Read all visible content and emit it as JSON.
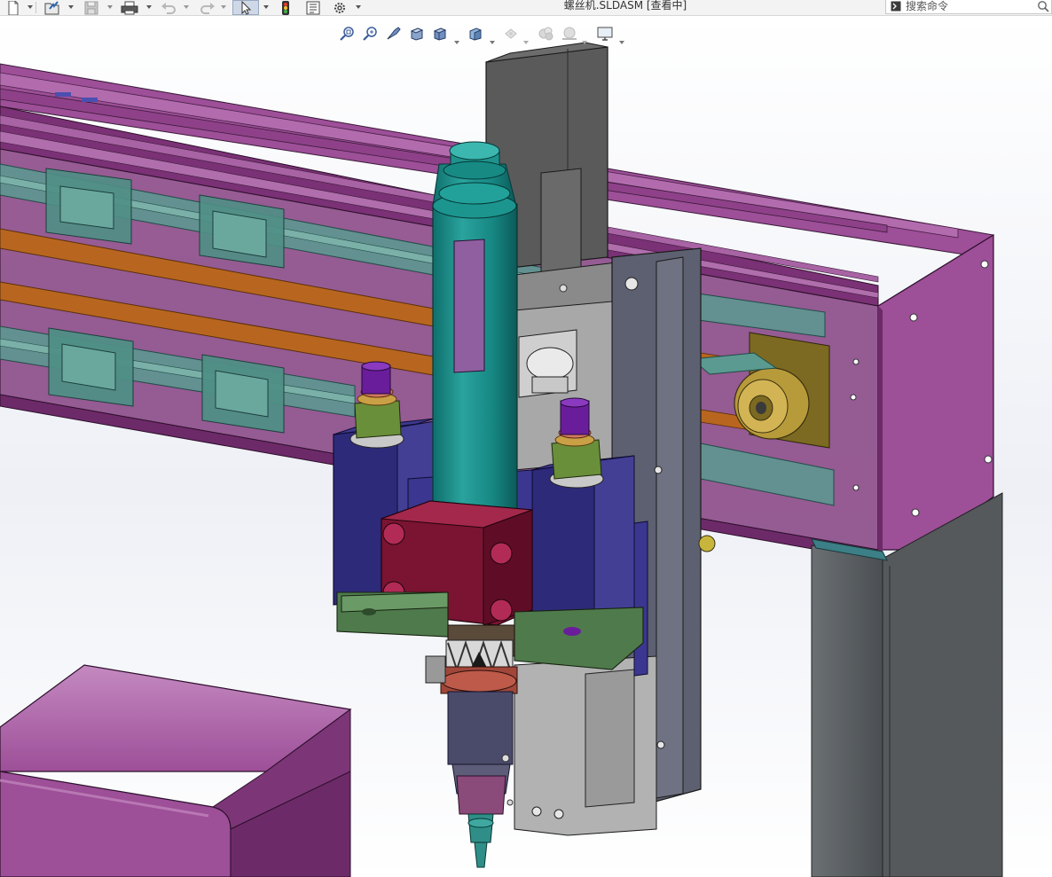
{
  "window": {
    "title": "螺丝机.SLDASM [查看中]"
  },
  "toolbar": {
    "items": [
      {
        "name": "new-document-button",
        "icon": "new-document-icon"
      },
      {
        "name": "open-button",
        "icon": "open-folder-icon"
      },
      {
        "name": "save-button",
        "icon": "save-icon"
      },
      {
        "name": "print-button",
        "icon": "printer-icon"
      },
      {
        "name": "undo-button",
        "icon": "undo-icon"
      },
      {
        "name": "redo-button",
        "icon": "redo-icon"
      },
      {
        "name": "select-button",
        "icon": "cursor-icon"
      },
      {
        "name": "rebuild-button",
        "icon": "traffic-light-icon"
      },
      {
        "name": "file-properties-button",
        "icon": "file-properties-icon"
      },
      {
        "name": "options-button",
        "icon": "gear-icon"
      }
    ]
  },
  "search": {
    "placeholder": "搜索命令"
  },
  "view_toolbar": {
    "items": [
      {
        "name": "zoom-to-fit-button",
        "icon": "zoom-fit-icon"
      },
      {
        "name": "zoom-to-area-button",
        "icon": "zoom-area-icon"
      },
      {
        "name": "previous-view-button",
        "icon": "previous-view-icon"
      },
      {
        "name": "section-view-button",
        "icon": "section-view-icon"
      },
      {
        "name": "view-orientation-button",
        "icon": "view-orientation-icon"
      },
      {
        "name": "display-style-button",
        "icon": "display-style-icon"
      },
      {
        "name": "hide-show-items-button",
        "icon": "hide-show-icon"
      },
      {
        "name": "edit-appearance-button",
        "icon": "appearance-icon"
      },
      {
        "name": "apply-scene-button",
        "icon": "scene-icon"
      },
      {
        "name": "view-settings-button",
        "icon": "monitor-icon"
      }
    ]
  },
  "colors": {
    "frame_purple": "#8a3c86",
    "frame_purple_light": "#a058a0",
    "rail_teal": "#4f8f86",
    "belt_orange": "#b4641e",
    "driver_teal": "#1f8f8a",
    "block_navy": "#2e2a7a",
    "clamp_red": "#8a1838",
    "motor_gray": "#5a5a5a",
    "post_gray": "#555a5c",
    "plate_green": "#4f7a4c"
  }
}
